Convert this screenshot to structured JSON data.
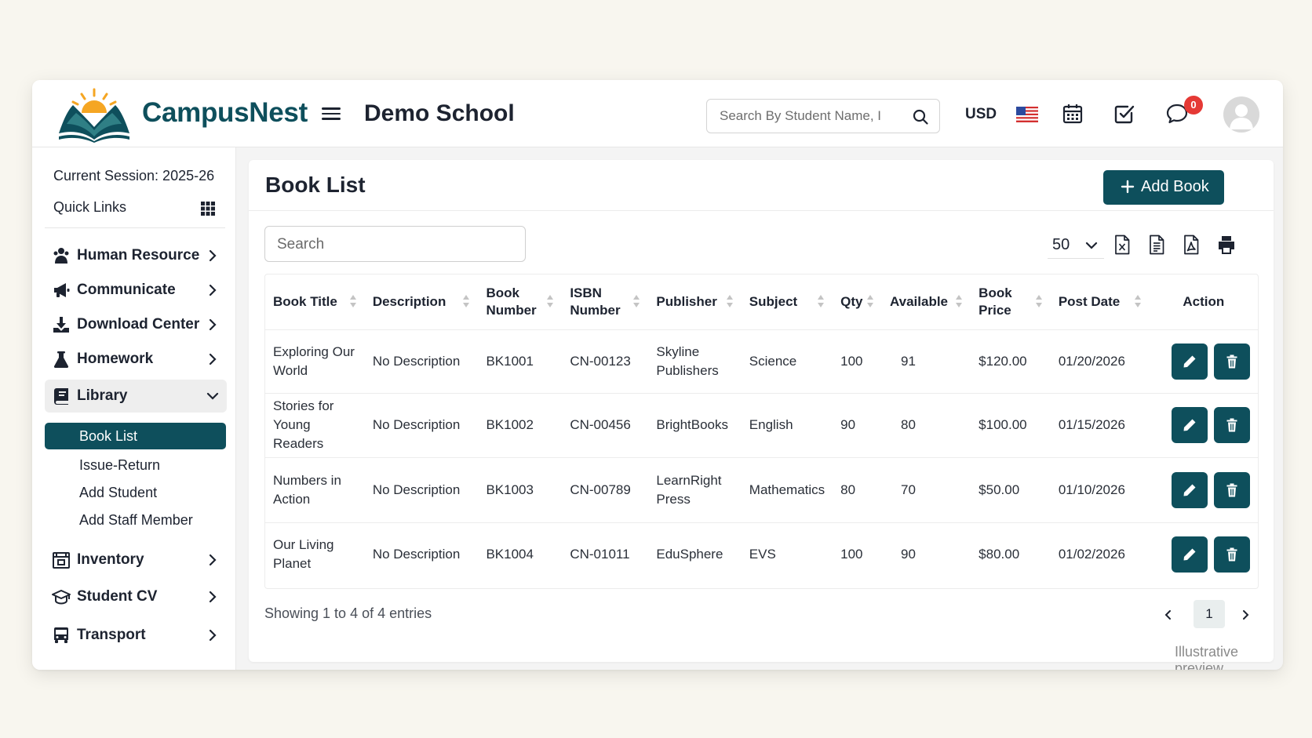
{
  "brand": {
    "name": "CampusNest",
    "accent": "#0e4f5c",
    "sun": "#f5a623"
  },
  "header": {
    "school_name": "Demo School",
    "search_placeholder": "Search By Student Name, I",
    "currency": "USD",
    "notification_count": "0",
    "icons": [
      "menu-icon",
      "search-icon",
      "us-flag-icon",
      "calendar-icon",
      "checkbox-icon",
      "chat-icon",
      "avatar"
    ]
  },
  "sidebar": {
    "session": "Current Session: 2025-26",
    "quick_links": "Quick Links",
    "items": [
      {
        "label": "Human Resource",
        "icon": "users-icon"
      },
      {
        "label": "Communicate",
        "icon": "megaphone-icon"
      },
      {
        "label": "Download Center",
        "icon": "download-icon"
      },
      {
        "label": "Homework",
        "icon": "flask-icon"
      },
      {
        "label": "Library",
        "icon": "book-icon",
        "expanded": true
      },
      {
        "label": "Inventory",
        "icon": "inventory-icon"
      },
      {
        "label": "Student CV",
        "icon": "graduation-cap-icon"
      },
      {
        "label": "Transport",
        "icon": "bus-icon"
      }
    ],
    "library_sub": [
      {
        "label": "Book List",
        "active": true
      },
      {
        "label": "Issue-Return"
      },
      {
        "label": "Add Student"
      },
      {
        "label": "Add Staff Member"
      }
    ]
  },
  "main": {
    "title": "Book List",
    "add_button": "Add Book",
    "search_placeholder": "Search",
    "page_size": "50",
    "export_icons": [
      "excel-icon",
      "csv-icon",
      "pdf-icon",
      "print-icon"
    ],
    "columns": [
      "Book Title",
      "Description",
      "Book Number",
      "ISBN Number",
      "Publisher",
      "Subject",
      "Qty",
      "Available",
      "Book Price",
      "Post Date",
      "Action"
    ],
    "rows": [
      [
        "Exploring Our World",
        "No Description",
        "BK1001",
        "CN-00123",
        "Skyline Publishers",
        "Science",
        "100",
        "91",
        "$120.00",
        "01/20/2026"
      ],
      [
        "Stories for Young Readers",
        "No Description",
        "BK1002",
        "CN-00456",
        "BrightBooks",
        "English",
        "90",
        "80",
        "$100.00",
        "01/15/2026"
      ],
      [
        "Numbers in Action",
        "No Description",
        "BK1003",
        "CN-00789",
        "LearnRight Press",
        "Mathematics",
        "80",
        "70",
        "$50.00",
        "01/10/2026"
      ],
      [
        "Our Living Planet",
        "No Description",
        "BK1004",
        "CN-01011",
        "EduSphere",
        "EVS",
        "100",
        "90",
        "$80.00",
        "01/02/2026"
      ]
    ],
    "showing": "Showing 1 to 4 of 4 entries",
    "current_page": "1",
    "watermark": "Illustrative preview"
  }
}
